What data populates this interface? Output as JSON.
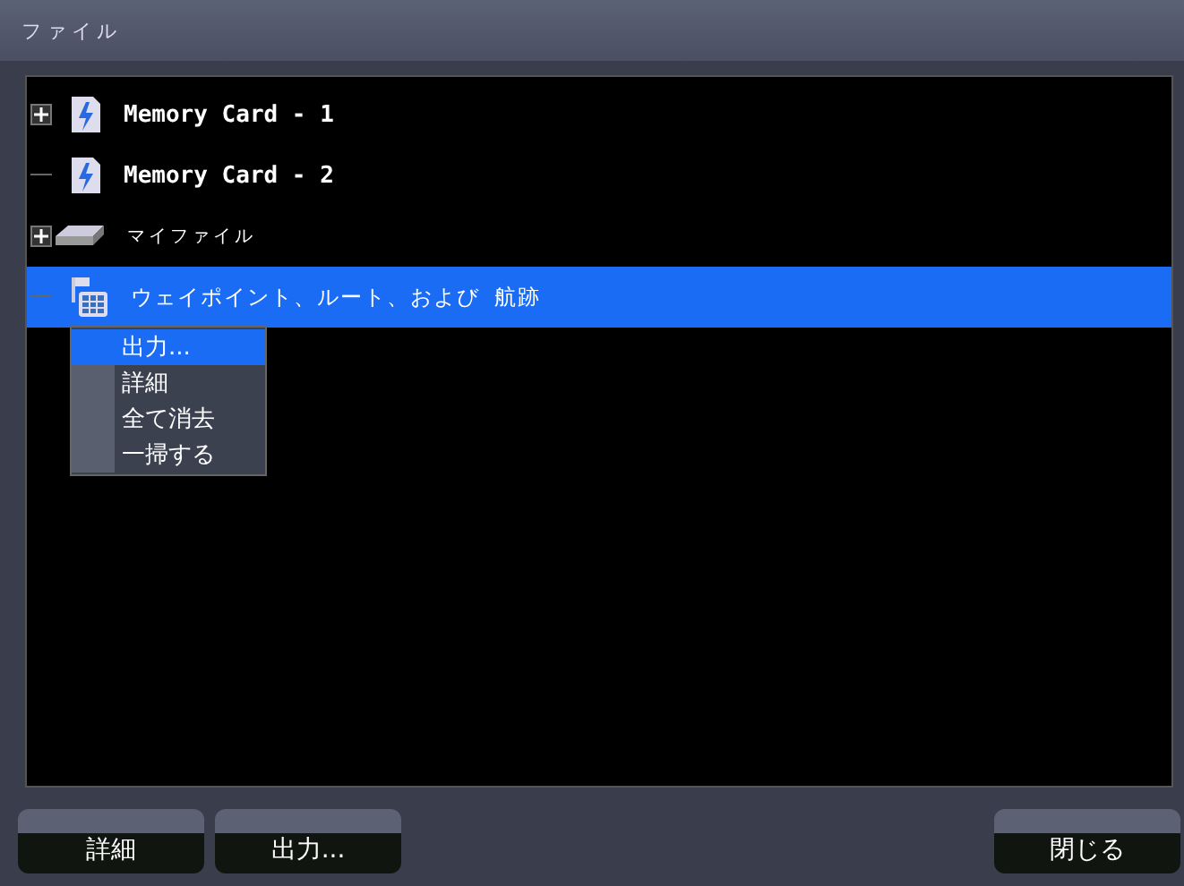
{
  "window": {
    "title": "ファイル"
  },
  "tree": [
    {
      "label": "Memory Card - 1",
      "kind": "card",
      "expandable": true,
      "selected": false
    },
    {
      "label": "Memory Card - 2",
      "kind": "card",
      "expandable": false,
      "selected": false
    },
    {
      "label": "マイファイル",
      "kind": "drive",
      "expandable": true,
      "selected": false
    },
    {
      "label": "ウェイポイント、ルート、および 航跡",
      "kind": "waypoints",
      "expandable": false,
      "selected": true
    }
  ],
  "context_menu": [
    {
      "label": "出力...",
      "selected": true
    },
    {
      "label": "詳細",
      "selected": false
    },
    {
      "label": "全て消去",
      "selected": false
    },
    {
      "label": "一掃する",
      "selected": false
    }
  ],
  "left_buttons": [
    {
      "label": "詳細"
    },
    {
      "label": "出力..."
    }
  ],
  "right_buttons": [
    {
      "label": "閉じる"
    }
  ]
}
